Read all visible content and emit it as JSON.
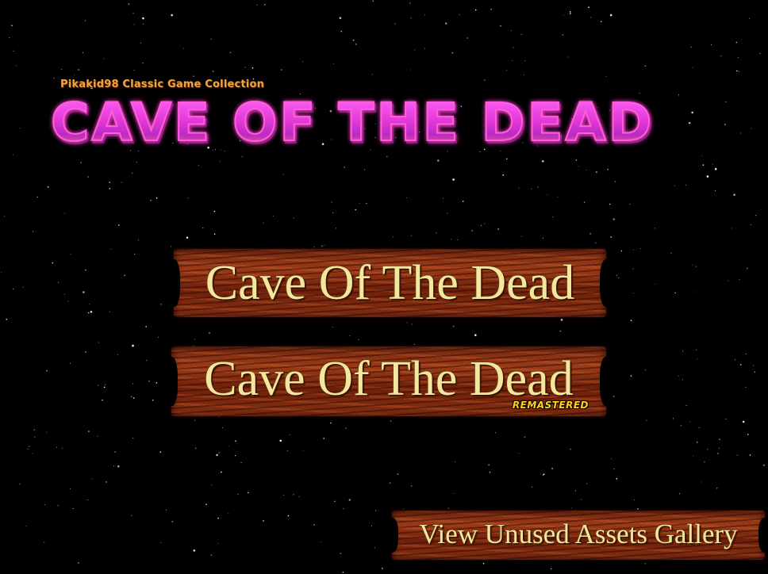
{
  "header": {
    "subtitle": "Pikakid98 Classic Game Collection",
    "logo_title": "CAVE OF THE DEAD"
  },
  "menu": {
    "items": [
      {
        "label": "Cave Of The Dead",
        "badge": ""
      },
      {
        "label": "Cave Of The Dead",
        "badge": "REMASTERED"
      }
    ],
    "gallery_label": "View Unused Assets Gallery"
  },
  "colors": {
    "background": "#000000",
    "logo_accent": "#ff4de0",
    "subtitle": "#f4a53a",
    "plank_wood": "#8a3014",
    "label_cream": "#f3e7a0",
    "badge_yellow": "#ffd31a"
  }
}
